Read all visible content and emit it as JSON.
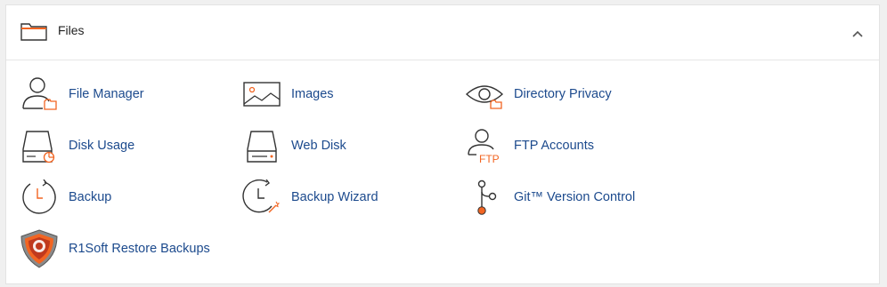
{
  "section": {
    "title": "Files",
    "title_icon": "folder-icon",
    "collapse_icon": "chevron-up-icon"
  },
  "items": [
    {
      "label": "File Manager",
      "icon": "file-manager-icon"
    },
    {
      "label": "Images",
      "icon": "images-icon"
    },
    {
      "label": "Directory Privacy",
      "icon": "directory-privacy-icon"
    },
    {
      "label": "Disk Usage",
      "icon": "disk-usage-icon"
    },
    {
      "label": "Web Disk",
      "icon": "web-disk-icon"
    },
    {
      "label": "FTP Accounts",
      "icon": "ftp-accounts-icon"
    },
    {
      "label": "Backup",
      "icon": "backup-icon"
    },
    {
      "label": "Backup Wizard",
      "icon": "backup-wizard-icon"
    },
    {
      "label": "Git™ Version Control",
      "icon": "git-icon"
    },
    {
      "label": "R1Soft Restore Backups",
      "icon": "r1soft-icon"
    }
  ],
  "colors": {
    "link": "#1c4a8d",
    "accent": "#f26522",
    "icon_stroke": "#333333"
  }
}
